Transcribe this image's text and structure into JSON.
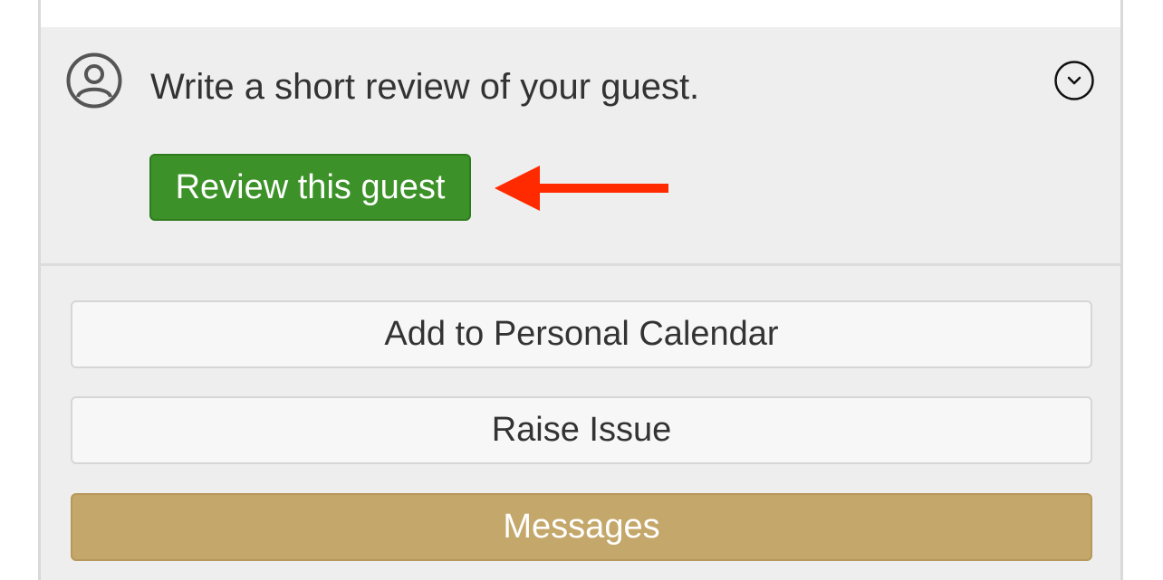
{
  "review_section": {
    "prompt": "Write a short review of your guest.",
    "review_button_label": "Review this guest",
    "user_icon": "user-circle-icon",
    "expand_icon": "chevron-down-circle-icon",
    "arrow_icon": "red-arrow-left-icon",
    "button_color": "#3c9228",
    "arrow_color": "#ff2a00"
  },
  "actions": {
    "add_calendar_label": "Add to Personal Calendar",
    "raise_issue_label": "Raise Issue",
    "messages_label": "Messages",
    "messages_color": "#c4a76a"
  }
}
